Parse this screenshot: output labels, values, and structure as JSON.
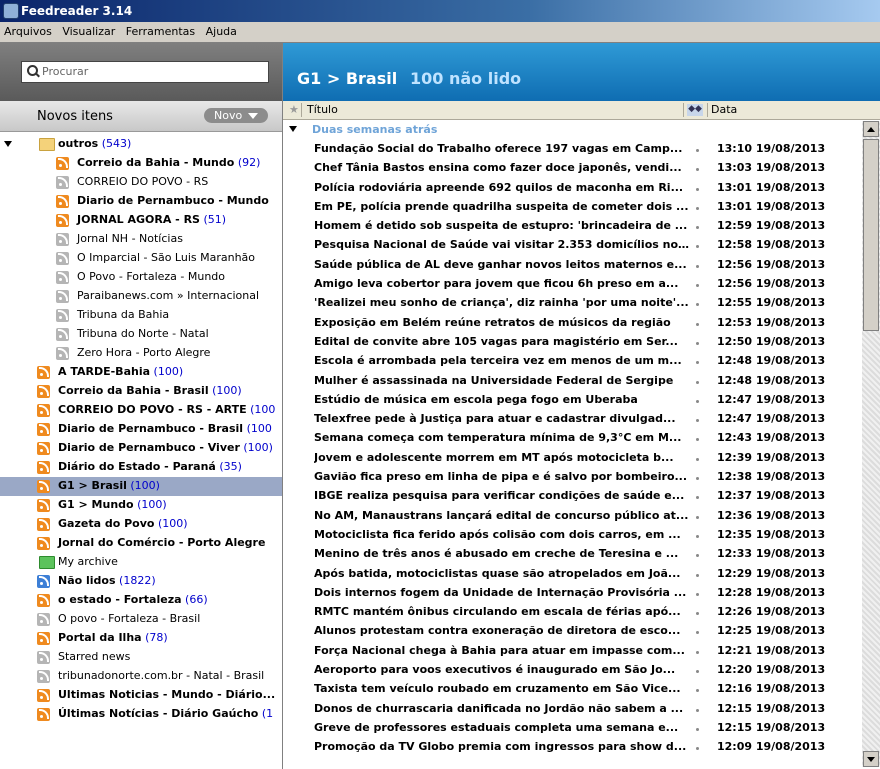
{
  "window": {
    "title": "Feedreader 3.14"
  },
  "menu": [
    "Arquivos",
    "Visualizar",
    "Ferramentas",
    "Ajuda"
  ],
  "search": {
    "placeholder": "Procurar"
  },
  "new_items": {
    "title": "Novos itens",
    "button": "Novo"
  },
  "tree": [
    {
      "type": "folder",
      "name": "outros",
      "count": "(543)",
      "bold": true,
      "expanded": true,
      "level": 0
    },
    {
      "type": "feed",
      "icon": "orange",
      "name": "Correio da Bahia - Mundo",
      "count": "(92)",
      "bold": true,
      "level": 1
    },
    {
      "type": "feed",
      "icon": "gray",
      "name": "CORREIO DO POVO - RS",
      "count": "",
      "bold": false,
      "level": 1
    },
    {
      "type": "feed",
      "icon": "orange",
      "name": "Diario de Pernambuco - Mundo",
      "count": "",
      "bold": true,
      "level": 1
    },
    {
      "type": "feed",
      "icon": "orange",
      "name": "JORNAL AGORA - RS",
      "count": "(51)",
      "bold": true,
      "level": 1
    },
    {
      "type": "feed",
      "icon": "gray",
      "name": "Jornal NH - Notícias",
      "count": "",
      "bold": false,
      "level": 1
    },
    {
      "type": "feed",
      "icon": "gray",
      "name": "O Imparcial - São Luis Maranhão",
      "count": "",
      "bold": false,
      "level": 1
    },
    {
      "type": "feed",
      "icon": "gray",
      "name": "O Povo - Fortaleza - Mundo",
      "count": "",
      "bold": false,
      "level": 1
    },
    {
      "type": "feed",
      "icon": "gray",
      "name": "Paraibanews.com » Internacional",
      "count": "",
      "bold": false,
      "level": 1
    },
    {
      "type": "feed",
      "icon": "gray",
      "name": "Tribuna da Bahia",
      "count": "",
      "bold": false,
      "level": 1
    },
    {
      "type": "feed",
      "icon": "gray",
      "name": "Tribuna do Norte - Natal",
      "count": "",
      "bold": false,
      "level": 1
    },
    {
      "type": "feed",
      "icon": "gray",
      "name": "Zero Hora - Porto Alegre",
      "count": "",
      "bold": false,
      "level": 1
    },
    {
      "type": "feed",
      "icon": "orange",
      "name": "A TARDE-Bahia",
      "count": "(100)",
      "bold": true,
      "level": 0
    },
    {
      "type": "feed",
      "icon": "orange",
      "name": "Correio da Bahia - Brasil",
      "count": "(100)",
      "bold": true,
      "level": 0
    },
    {
      "type": "feed",
      "icon": "orange",
      "name": "CORREIO DO POVO - RS - ARTE",
      "count": "(100",
      "bold": true,
      "level": 0
    },
    {
      "type": "feed",
      "icon": "orange",
      "name": "Diario de Pernambuco - Brasil",
      "count": "(100",
      "bold": true,
      "level": 0
    },
    {
      "type": "feed",
      "icon": "orange",
      "name": "Diario de Pernambuco - Viver",
      "count": "(100)",
      "bold": true,
      "level": 0
    },
    {
      "type": "feed",
      "icon": "orange",
      "name": "Diário do Estado - Paraná",
      "count": "(35)",
      "bold": true,
      "level": 0
    },
    {
      "type": "feed",
      "icon": "orange",
      "name": "G1 > Brasil",
      "count": "(100)",
      "bold": true,
      "level": 0,
      "selected": true
    },
    {
      "type": "feed",
      "icon": "orange",
      "name": "G1 > Mundo",
      "count": "(100)",
      "bold": true,
      "level": 0
    },
    {
      "type": "feed",
      "icon": "orange",
      "name": "Gazeta do Povo",
      "count": "(100)",
      "bold": true,
      "level": 0
    },
    {
      "type": "feed",
      "icon": "orange",
      "name": "Jornal do Comércio - Porto Alegre",
      "count": "",
      "bold": true,
      "level": 0
    },
    {
      "type": "folder-green",
      "name": "My archive",
      "count": "",
      "bold": false,
      "level": 0
    },
    {
      "type": "feed",
      "icon": "blue",
      "name": "Não lidos",
      "count": "(1822)",
      "bold": true,
      "level": 0
    },
    {
      "type": "feed",
      "icon": "orange",
      "name": "o estado - Fortaleza",
      "count": "(66)",
      "bold": true,
      "level": 0
    },
    {
      "type": "feed",
      "icon": "gray",
      "name": "O povo - Fortaleza - Brasil",
      "count": "",
      "bold": false,
      "level": 0
    },
    {
      "type": "feed",
      "icon": "orange",
      "name": "Portal da Ilha",
      "count": "(78)",
      "bold": true,
      "level": 0
    },
    {
      "type": "feed",
      "icon": "gray",
      "name": "Starred news",
      "count": "",
      "bold": false,
      "level": 0
    },
    {
      "type": "feed",
      "icon": "gray",
      "name": "tribunadonorte.com.br - Natal - Brasil",
      "count": "",
      "bold": false,
      "level": 0
    },
    {
      "type": "feed",
      "icon": "orange",
      "name": "Ultimas Noticias - Mundo - Diário...",
      "count": "",
      "bold": true,
      "level": 0
    },
    {
      "type": "feed",
      "icon": "orange",
      "name": "Últimas Notícias - Diário Gaúcho",
      "count": "(1",
      "bold": true,
      "level": 0
    }
  ],
  "feed_header": {
    "title": "G1 > Brasil",
    "unread": "100 não lido"
  },
  "columns": {
    "title": "Título",
    "date": "Data"
  },
  "group": "Duas semanas atrás",
  "articles": [
    {
      "title": "Fundação Social do Trabalho oferece 197 vagas em Camp...",
      "date": "13:10 19/08/2013"
    },
    {
      "title": "Chef Tânia Bastos ensina como fazer doce japonês, vendi...",
      "date": "13:03 19/08/2013"
    },
    {
      "title": "Polícia rodoviária apreende 692 quilos de maconha em Ri...",
      "date": "13:01 19/08/2013"
    },
    {
      "title": "Em PE, polícia prende quadrilha suspeita de cometer dois ...",
      "date": "13:01 19/08/2013"
    },
    {
      "title": "Homem é detido sob suspeita de estupro: 'brincadeira de ...",
      "date": "12:59 19/08/2013"
    },
    {
      "title": "Pesquisa Nacional de Saúde vai visitar 2.353 domicílios no...",
      "date": "12:58 19/08/2013"
    },
    {
      "title": "Saúde pública de AL deve ganhar novos leitos maternos e...",
      "date": "12:56 19/08/2013"
    },
    {
      "title": "Amigo leva cobertor para jovem que  ficou 6h preso em a...",
      "date": "12:56 19/08/2013"
    },
    {
      "title": "'Realizei meu sonho de criança', diz rainha 'por uma noite'...",
      "date": "12:55 19/08/2013"
    },
    {
      "title": "Exposição em Belém reúne retratos de músicos da região",
      "date": "12:53 19/08/2013"
    },
    {
      "title": "Edital de convite abre 105 vagas para magistério em Ser...",
      "date": "12:50 19/08/2013"
    },
    {
      "title": "Escola é arrombada pela terceira vez em menos de um m...",
      "date": "12:48 19/08/2013"
    },
    {
      "title": "Mulher é assassinada na Universidade Federal de Sergipe",
      "date": "12:48 19/08/2013"
    },
    {
      "title": "Estúdio de música em escola pega fogo em Uberaba",
      "date": "12:47 19/08/2013"
    },
    {
      "title": "Telexfree pede à Justiça para atuar e cadastrar divulgad...",
      "date": "12:47 19/08/2013"
    },
    {
      "title": "Semana começa com temperatura mínima de 9,3°C em M...",
      "date": "12:43 19/08/2013"
    },
    {
      "title": "Jovem e adolescente morrem em MT após motocicleta b...",
      "date": "12:39 19/08/2013"
    },
    {
      "title": "Gavião fica preso em linha de pipa e é salvo por bombeiro...",
      "date": "12:38 19/08/2013"
    },
    {
      "title": "IBGE realiza pesquisa para verificar condições de saúde e...",
      "date": "12:37 19/08/2013"
    },
    {
      "title": "No AM, Manaustrans lançará edital de concurso público at...",
      "date": "12:36 19/08/2013"
    },
    {
      "title": "Motociclista fica ferido após colisão com dois carros, em ...",
      "date": "12:35 19/08/2013"
    },
    {
      "title": "Menino de três anos é abusado em creche de Teresina e ...",
      "date": "12:33 19/08/2013"
    },
    {
      "title": "Após batida, motociclistas quase são atropelados em Joã...",
      "date": "12:29 19/08/2013"
    },
    {
      "title": "Dois internos fogem da Unidade de Internação Provisória ...",
      "date": "12:28 19/08/2013"
    },
    {
      "title": "RMTC mantém ônibus circulando em escala de férias apó...",
      "date": "12:26 19/08/2013"
    },
    {
      "title": "Alunos protestam contra exoneração de diretora de esco...",
      "date": "12:25 19/08/2013"
    },
    {
      "title": "Força Nacional chega à Bahia para atuar em impasse com...",
      "date": "12:21 19/08/2013"
    },
    {
      "title": "Aeroporto para voos executivos é inaugurado em São Jo...",
      "date": "12:20 19/08/2013"
    },
    {
      "title": "Taxista tem veículo roubado em cruzamento em São Vice...",
      "date": "12:16 19/08/2013"
    },
    {
      "title": "Donos de churrascaria danificada no Jordão não sabem a ...",
      "date": "12:15 19/08/2013"
    },
    {
      "title": "Greve de professores estaduais completa uma semana e...",
      "date": "12:15 19/08/2013"
    },
    {
      "title": "Promoção da TV Globo premia com ingressos para show d...",
      "date": "12:09 19/08/2013"
    }
  ]
}
